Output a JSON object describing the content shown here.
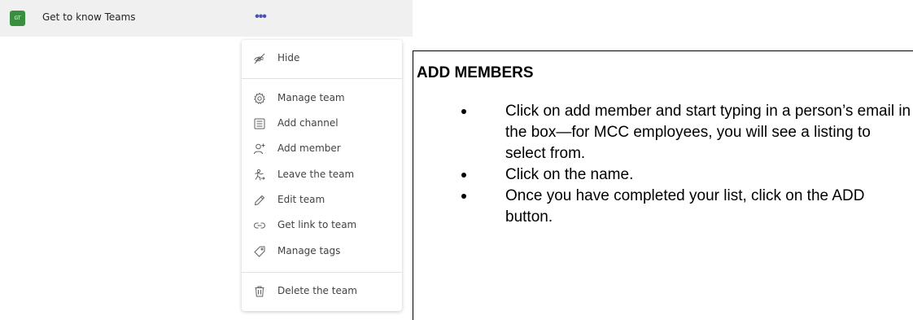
{
  "team": {
    "avatar_initials": "GT",
    "name": "Get to know Teams",
    "more_label": "•••",
    "avatar_color": "#3a8e3f",
    "more_color": "#4f52b2"
  },
  "menu": {
    "items": [
      {
        "label": "Hide",
        "icon": "hide-icon"
      },
      {
        "label": "Manage team",
        "icon": "gear-icon"
      },
      {
        "label": "Add channel",
        "icon": "channel-icon"
      },
      {
        "label": "Add member",
        "icon": "add-person-icon"
      },
      {
        "label": "Leave the team",
        "icon": "leave-icon"
      },
      {
        "label": "Edit team",
        "icon": "pencil-icon"
      },
      {
        "label": "Get link to team",
        "icon": "link-icon"
      },
      {
        "label": "Manage tags",
        "icon": "tag-icon"
      },
      {
        "label": "Delete the team",
        "icon": "trash-icon"
      }
    ]
  },
  "panel": {
    "title": "ADD MEMBERS",
    "bullets": [
      "Click on add member and start typing in a person’s email in the box—for MCC employees, you will see a listing to select from.",
      "Click on the name.",
      "Once you have completed your list, click on the ADD button."
    ]
  }
}
